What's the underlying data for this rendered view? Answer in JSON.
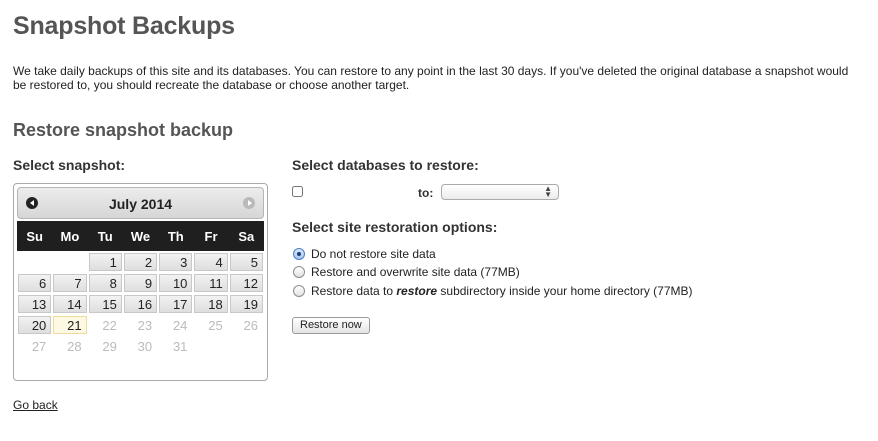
{
  "page": {
    "title": "Snapshot Backups",
    "intro": "We take daily backups of this site and its databases. You can restore to any point in the last 30 days. If you've deleted the original database a snapshot would be restored to, you should recreate the database or choose another target."
  },
  "restore": {
    "section_title": "Restore snapshot backup",
    "select_snapshot_label": "Select snapshot:",
    "select_databases_label": "Select databases to restore:",
    "to_label": "to:",
    "site_options_label": "Select site restoration options:",
    "options": [
      {
        "label": "Do not restore site data",
        "checked": true
      },
      {
        "label": "Restore and overwrite site data (77MB)",
        "checked": false
      },
      {
        "label_before": "Restore data to ",
        "label_emph": "restore",
        "label_after": " subdirectory inside your home directory (77MB)",
        "checked": false
      }
    ],
    "restore_button": "Restore now"
  },
  "calendar": {
    "month_label": "July 2014",
    "weekdays": [
      "Su",
      "Mo",
      "Tu",
      "We",
      "Th",
      "Fr",
      "Sa"
    ],
    "weeks": [
      [
        null,
        null,
        {
          "d": "1",
          "s": "active"
        },
        {
          "d": "2",
          "s": "active"
        },
        {
          "d": "3",
          "s": "active"
        },
        {
          "d": "4",
          "s": "active"
        },
        {
          "d": "5",
          "s": "active"
        }
      ],
      [
        {
          "d": "6",
          "s": "active"
        },
        {
          "d": "7",
          "s": "active"
        },
        {
          "d": "8",
          "s": "active"
        },
        {
          "d": "9",
          "s": "active"
        },
        {
          "d": "10",
          "s": "active"
        },
        {
          "d": "11",
          "s": "active"
        },
        {
          "d": "12",
          "s": "active"
        }
      ],
      [
        {
          "d": "13",
          "s": "active"
        },
        {
          "d": "14",
          "s": "active"
        },
        {
          "d": "15",
          "s": "active"
        },
        {
          "d": "16",
          "s": "active"
        },
        {
          "d": "17",
          "s": "active"
        },
        {
          "d": "18",
          "s": "active"
        },
        {
          "d": "19",
          "s": "active"
        }
      ],
      [
        {
          "d": "20",
          "s": "active"
        },
        {
          "d": "21",
          "s": "today"
        },
        {
          "d": "22",
          "s": "disabled"
        },
        {
          "d": "23",
          "s": "disabled"
        },
        {
          "d": "24",
          "s": "disabled"
        },
        {
          "d": "25",
          "s": "disabled"
        },
        {
          "d": "26",
          "s": "disabled"
        }
      ],
      [
        {
          "d": "27",
          "s": "disabled"
        },
        {
          "d": "28",
          "s": "disabled"
        },
        {
          "d": "29",
          "s": "disabled"
        },
        {
          "d": "30",
          "s": "disabled"
        },
        {
          "d": "31",
          "s": "disabled"
        },
        null,
        null
      ]
    ]
  },
  "footer": {
    "go_back": "Go back"
  }
}
